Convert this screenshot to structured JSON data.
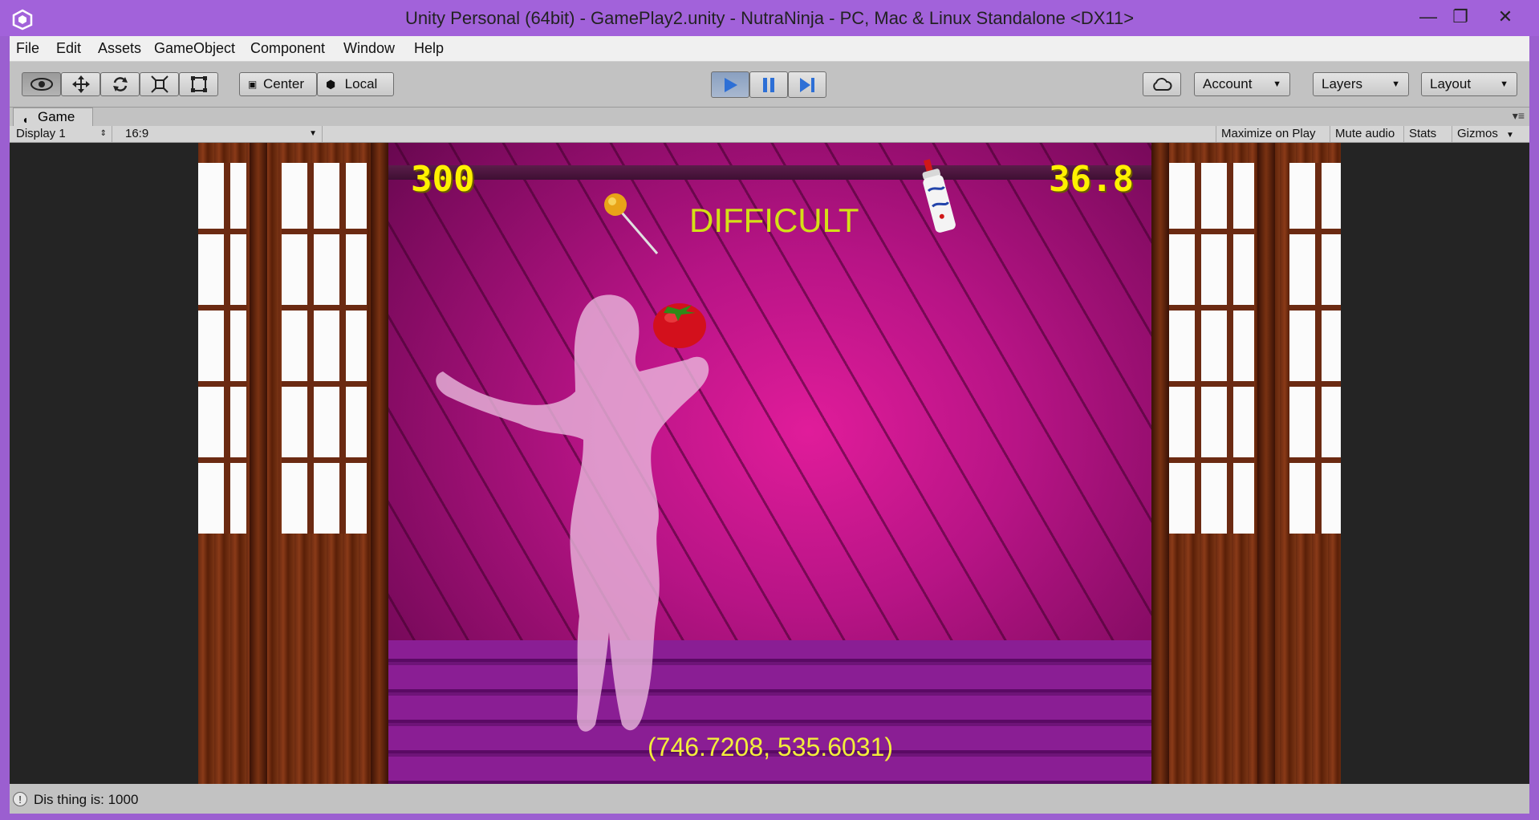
{
  "window": {
    "title": "Unity Personal (64bit) - GamePlay2.unity - NutraNinja - PC, Mac & Linux Standalone <DX11>",
    "minimize_glyph": "—",
    "maximize_glyph": "❐",
    "close_glyph": "✕"
  },
  "menu": [
    "File",
    "Edit",
    "Assets",
    "GameObject",
    "Component",
    "Window",
    "Help"
  ],
  "toolbar": {
    "tools": [
      "view-tool-icon",
      "move-tool-icon",
      "rotate-tool-icon",
      "scale-tool-icon",
      "rect-tool-icon"
    ],
    "pivot_label": "Center",
    "space_label": "Local",
    "account_label": "Account",
    "layers_label": "Layers",
    "layout_label": "Layout",
    "play_state": "playing",
    "colors": {
      "play_active": "#2d6fd6"
    }
  },
  "tab": {
    "label": "Game"
  },
  "gamebar": {
    "display": "Display 1",
    "aspect": "16:9",
    "maximize_label": "Maximize on Play",
    "mute_label": "Mute audio",
    "stats_label": "Stats",
    "gizmos_label": "Gizmos"
  },
  "game": {
    "score": "300",
    "timer": "36.8",
    "difficulty": "DIFFICULT",
    "coords": "(746.7208, 535.6031)",
    "colors": {
      "hud_text": "#fff100",
      "difficulty_text": "#d4e016",
      "coords_text": "#f2ee3a"
    }
  },
  "status": {
    "message": "Dis thing is: 1000"
  }
}
